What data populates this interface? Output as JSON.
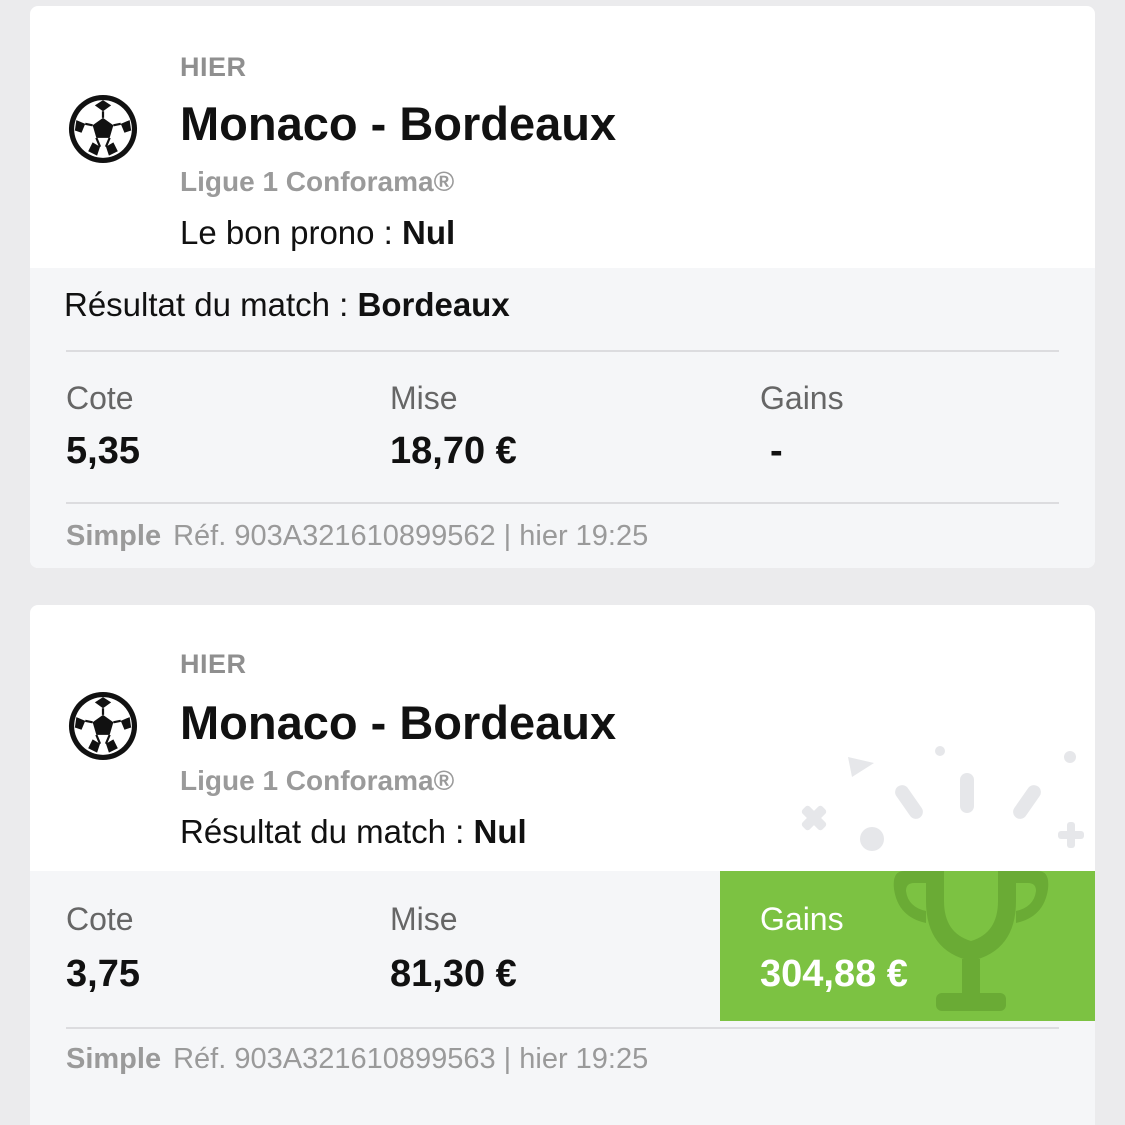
{
  "bets": [
    {
      "day": "HIER",
      "teams": "Monaco - Bordeaux",
      "league": "Ligue 1 Conforama®",
      "outcome_label": "Le bon prono : ",
      "outcome_value": "Nul",
      "result_label": "Résultat du match : ",
      "result_value": "Bordeaux",
      "cote_label": "Cote",
      "cote_value": "5,35",
      "mise_label": "Mise",
      "mise_value": "18,70 €",
      "gains_label": "Gains",
      "gains_value": "-",
      "type": "Simple",
      "ref": "Réf. 903A321610899562 | hier 19:25",
      "icon": "soccer-ball-icon"
    },
    {
      "day": "HIER",
      "teams": "Monaco - Bordeaux",
      "league": "Ligue 1 Conforama®",
      "outcome_label": "Résultat du match : ",
      "outcome_value": "Nul",
      "cote_label": "Cote",
      "cote_value": "3,75",
      "mise_label": "Mise",
      "mise_value": "81,30 €",
      "gains_label": "Gains",
      "gains_value": "304,88 €",
      "type": "Simple",
      "ref": "Réf. 903A321610899563 | hier 19:25",
      "icon": "soccer-ball-icon",
      "gains_color": "#7cc242",
      "decoration_icon": "trophy-icon"
    }
  ],
  "colors": {
    "background": "#ebebed",
    "win_green": "#7cc242",
    "muted_text": "#9a9a9a"
  }
}
